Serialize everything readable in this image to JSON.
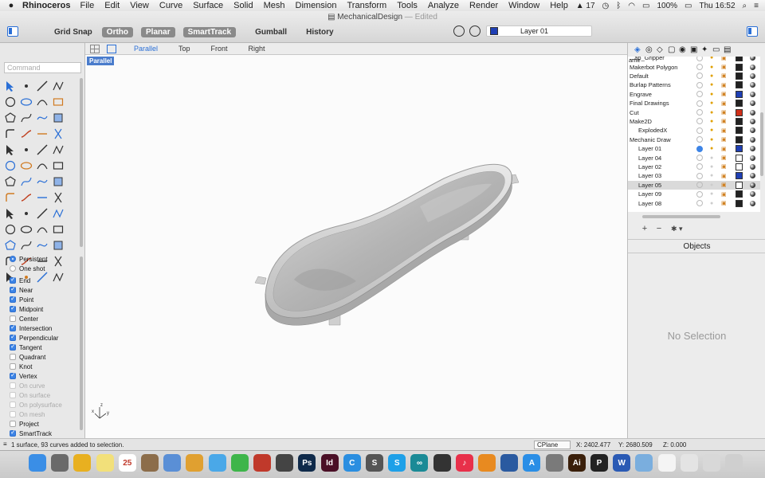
{
  "menubar": {
    "app_name": "Rhinoceros",
    "items": [
      "File",
      "Edit",
      "View",
      "Curve",
      "Surface",
      "Solid",
      "Mesh",
      "Dimension",
      "Transform",
      "Tools",
      "Analyze",
      "Render",
      "Window",
      "Help"
    ],
    "status": {
      "notifications": "17",
      "battery": "100%",
      "clock": "Thu 16:52"
    }
  },
  "window": {
    "title": "MechanicalDesign",
    "title_suffix": "— Edited"
  },
  "toolbar": {
    "grid_snap": "Grid Snap",
    "ortho": "Ortho",
    "planar": "Planar",
    "smarttrack": "SmartTrack",
    "gumball": "Gumball",
    "history": "History",
    "current_layer": "Layer 01",
    "current_layer_color": "#1f3fb4"
  },
  "command": {
    "placeholder": "Command"
  },
  "tools": [
    "select-arrow",
    "point",
    "line",
    "polyline",
    "circle",
    "ellipse",
    "arc",
    "rectangle",
    "polygon",
    "curve",
    "interpolate",
    "freeform",
    "fillet",
    "blend",
    "extend",
    "trim",
    "split",
    "join",
    "explode",
    "offset",
    "box",
    "sphere",
    "cylinder",
    "extrude",
    "boolean",
    "loft",
    "sweep",
    "revolve",
    "network",
    "patch",
    "plane",
    "planar-surface",
    "move",
    "copy",
    "rotate",
    "scale",
    "array",
    "mirror",
    "align",
    "orient",
    "transform",
    "project",
    "text",
    "dimension",
    "check",
    "analysis",
    "render",
    "camera",
    "zoom",
    "pan",
    "rotate-view",
    "properties"
  ],
  "osnap": {
    "modes": [
      {
        "label": "Persistent",
        "type": "radio",
        "on": true
      },
      {
        "label": "One shot",
        "type": "radio",
        "on": false
      }
    ],
    "snaps": [
      {
        "label": "End",
        "on": true,
        "disabled": false
      },
      {
        "label": "Near",
        "on": true,
        "disabled": false
      },
      {
        "label": "Point",
        "on": true,
        "disabled": false
      },
      {
        "label": "Midpoint",
        "on": true,
        "disabled": false
      },
      {
        "label": "Center",
        "on": false,
        "disabled": false
      },
      {
        "label": "Intersection",
        "on": true,
        "disabled": false
      },
      {
        "label": "Perpendicular",
        "on": true,
        "disabled": false
      },
      {
        "label": "Tangent",
        "on": true,
        "disabled": false
      },
      {
        "label": "Quadrant",
        "on": false,
        "disabled": false
      },
      {
        "label": "Knot",
        "on": false,
        "disabled": false
      },
      {
        "label": "Vertex",
        "on": true,
        "disabled": false
      },
      {
        "label": "On curve",
        "on": false,
        "disabled": true
      },
      {
        "label": "On surface",
        "on": false,
        "disabled": true
      },
      {
        "label": "On polysurface",
        "on": false,
        "disabled": true
      },
      {
        "label": "On mesh",
        "on": false,
        "disabled": true
      },
      {
        "label": "Project",
        "on": false,
        "disabled": false
      },
      {
        "label": "SmartTrack",
        "on": true,
        "disabled": false
      }
    ]
  },
  "viewport": {
    "tabs": [
      "Parallel",
      "Top",
      "Front",
      "Right"
    ],
    "active_tab": "Parallel",
    "label": "Parallel",
    "axis_labels": {
      "x": "x",
      "y": "y",
      "z": "z"
    }
  },
  "layers": {
    "header": "ame",
    "rows": [
      {
        "name": "...ap_Gripper",
        "indent": false,
        "current": false,
        "on": true,
        "locked": true,
        "color": "#222222"
      },
      {
        "name": "Makerbot Polygon",
        "indent": false,
        "current": false,
        "on": true,
        "locked": true,
        "color": "#222222"
      },
      {
        "name": "Default",
        "indent": false,
        "current": false,
        "on": true,
        "locked": true,
        "color": "#222222"
      },
      {
        "name": "Burlap Patterns",
        "indent": false,
        "current": false,
        "on": true,
        "locked": true,
        "color": "#222222"
      },
      {
        "name": "Engrave",
        "indent": false,
        "current": false,
        "on": true,
        "locked": true,
        "color": "#1f3fb4"
      },
      {
        "name": "Final Drawings",
        "indent": false,
        "current": false,
        "on": true,
        "locked": true,
        "color": "#222222"
      },
      {
        "name": "Cut",
        "indent": false,
        "current": false,
        "on": true,
        "locked": true,
        "color": "#d0301a"
      },
      {
        "name": "Make2D",
        "indent": false,
        "current": false,
        "on": true,
        "locked": true,
        "color": "#222222"
      },
      {
        "name": "ExplodedX",
        "indent": true,
        "current": false,
        "on": true,
        "locked": true,
        "color": "#222222"
      },
      {
        "name": "Mechanic Draw",
        "indent": false,
        "current": false,
        "on": true,
        "locked": true,
        "color": "#222222"
      },
      {
        "name": "Layer 01",
        "indent": true,
        "current": true,
        "on": true,
        "locked": false,
        "color": "#1f3fb4"
      },
      {
        "name": "Layer 04",
        "indent": true,
        "current": false,
        "on": false,
        "locked": true,
        "color": "#ffffff"
      },
      {
        "name": "Layer 02",
        "indent": true,
        "current": false,
        "on": false,
        "locked": true,
        "color": "#ffffff"
      },
      {
        "name": "Layer 03",
        "indent": true,
        "current": false,
        "on": false,
        "locked": true,
        "color": "#1f3fb4"
      },
      {
        "name": "Layer 05",
        "indent": true,
        "current": false,
        "on": false,
        "locked": true,
        "color": "#ffffff",
        "selected": true
      },
      {
        "name": "Layer 09",
        "indent": true,
        "current": false,
        "on": false,
        "locked": true,
        "color": "#222222"
      },
      {
        "name": "Layer 08",
        "indent": true,
        "current": false,
        "on": false,
        "locked": true,
        "color": "#222222"
      }
    ],
    "add_label": "+",
    "remove_label": "−",
    "gear_label": "✱ ▾"
  },
  "objects": {
    "header": "Objects",
    "empty_text": "No Selection"
  },
  "statusbar": {
    "message": "1 surface, 93 curves added to selection.",
    "cplane": "CPlane",
    "x": "X: 2402.477",
    "y": "Y: 2680.509",
    "z": "Z: 0.000"
  },
  "dock": {
    "apps": [
      {
        "name": "finder",
        "color": "#3a8ee6",
        "glyph": ""
      },
      {
        "name": "launchpad",
        "color": "#6a6a6a",
        "glyph": ""
      },
      {
        "name": "chrome",
        "color": "#e8b020",
        "glyph": ""
      },
      {
        "name": "stickies",
        "color": "#f2e07a",
        "glyph": ""
      },
      {
        "name": "calendar",
        "color": "#ffffff",
        "glyph": "25"
      },
      {
        "name": "notes",
        "color": "#8c6d4a",
        "glyph": ""
      },
      {
        "name": "preview",
        "color": "#5a8fd6",
        "glyph": ""
      },
      {
        "name": "photos",
        "color": "#e0a030",
        "glyph": ""
      },
      {
        "name": "messages",
        "color": "#4aa8e8",
        "glyph": ""
      },
      {
        "name": "facetime",
        "color": "#3eb54a",
        "glyph": ""
      },
      {
        "name": "photo-booth",
        "color": "#c0392b",
        "glyph": ""
      },
      {
        "name": "rhinoceros",
        "color": "#444444",
        "glyph": ""
      },
      {
        "name": "photoshop",
        "color": "#0f2a4a",
        "glyph": "Ps"
      },
      {
        "name": "indesign",
        "color": "#4a0f26",
        "glyph": "Id"
      },
      {
        "name": "c-app",
        "color": "#2a8ee0",
        "glyph": "C"
      },
      {
        "name": "sublime",
        "color": "#555555",
        "glyph": "S"
      },
      {
        "name": "skype",
        "color": "#1ea0e8",
        "glyph": "S"
      },
      {
        "name": "arduino",
        "color": "#1a8a96",
        "glyph": "∞"
      },
      {
        "name": "app-a",
        "color": "#333333",
        "glyph": ""
      },
      {
        "name": "music",
        "color": "#e8304a",
        "glyph": "♪"
      },
      {
        "name": "books",
        "color": "#e88a20",
        "glyph": ""
      },
      {
        "name": "app-b",
        "color": "#2a5aa0",
        "glyph": ""
      },
      {
        "name": "app-store",
        "color": "#2a8ee6",
        "glyph": "A"
      },
      {
        "name": "system-preferences",
        "color": "#7a7a7a",
        "glyph": ""
      },
      {
        "name": "illustrator",
        "color": "#3a1f0a",
        "glyph": "Ai"
      },
      {
        "name": "app-p",
        "color": "#222222",
        "glyph": "P"
      },
      {
        "name": "word",
        "color": "#2a5ab4",
        "glyph": "W"
      },
      {
        "name": "folder",
        "color": "#7aaede",
        "glyph": ""
      },
      {
        "name": "document",
        "color": "#f4f4f4",
        "glyph": ""
      },
      {
        "name": "image",
        "color": "#e4e4e4",
        "glyph": ""
      },
      {
        "name": "finder-window",
        "color": "#d8d8d8",
        "glyph": ""
      },
      {
        "name": "trash",
        "color": "#cfcfcf",
        "glyph": ""
      }
    ]
  }
}
